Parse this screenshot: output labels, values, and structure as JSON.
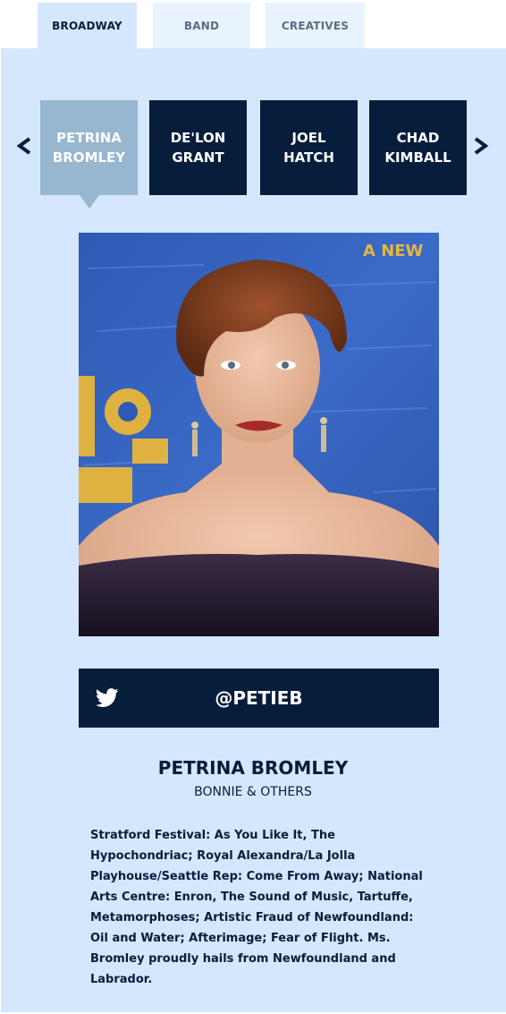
{
  "tabs": [
    {
      "label": "BROADWAY",
      "active": true
    },
    {
      "label": "BAND",
      "active": false
    },
    {
      "label": "CREATIVES",
      "active": false
    }
  ],
  "carousel": {
    "prev_label": "<",
    "next_label": ">",
    "cast": [
      {
        "first": "PETRINA",
        "last": "BROMLEY",
        "selected": true
      },
      {
        "first": "DE'LON",
        "last": "GRANT",
        "selected": false
      },
      {
        "first": "JOEL",
        "last": "HATCH",
        "selected": false
      },
      {
        "first": "CHAD",
        "last": "KIMBALL",
        "selected": false
      }
    ]
  },
  "profile": {
    "twitter_icon": "twitter-bird-icon",
    "twitter_handle": "@PETIEB",
    "name": "PETRINA BROMLEY",
    "role": "BONNIE & OTHERS",
    "bio": "Stratford Festival: As You Like It, The Hypochondriac; Royal Alexandra/La Jolla Playhouse/Seattle Rep: Come From Away; National Arts Centre: Enron, The Sound of Music, Tartuffe, Metamorphoses; Artistic Fraud of Newfoundland: Oil and Water; Afterimage; Fear of Flight. Ms. Bromley proudly hails from Newfoundland and Labrador.",
    "photo_backdrop_text": "A NEW"
  },
  "colors": {
    "navy": "#061d3c",
    "panel": "#d4e7fc",
    "tab_inactive": "#e9f3fe",
    "selected_card": "#97b6cf"
  }
}
